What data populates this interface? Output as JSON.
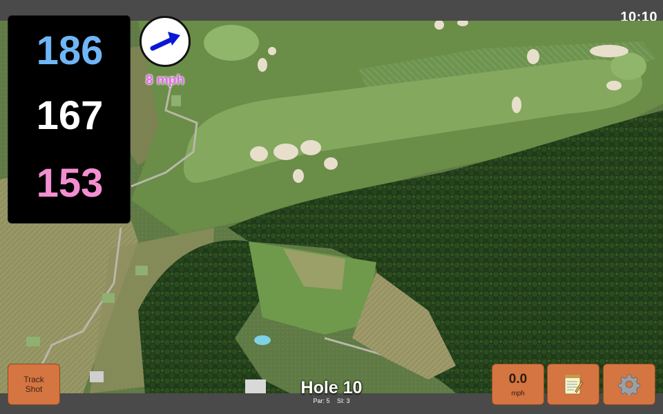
{
  "status": {
    "time": "10:10"
  },
  "distances": {
    "back": "186",
    "middle": "167",
    "front": "153",
    "colors": {
      "back": "#6fb6f7",
      "middle": "#ffffff",
      "front": "#f48ed3"
    }
  },
  "wind": {
    "speed_label": "8 mph",
    "icon": "wind-arrow-icon",
    "arrow_color": "#0a18d6"
  },
  "buttons": {
    "track_shot": "Track Shot",
    "speed_value": "0.0",
    "speed_unit": "mph",
    "notes_icon": "notepad-icon",
    "settings_icon": "gear-icon",
    "accent": "#d57541"
  },
  "hole": {
    "title": "Hole 10",
    "par_label": "Par: 5",
    "si_label": "SI: 3"
  }
}
